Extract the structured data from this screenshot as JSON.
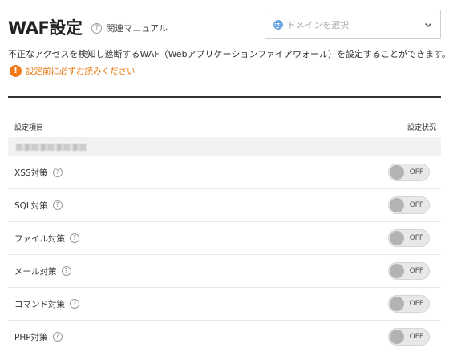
{
  "header": {
    "title": "WAF設定",
    "manual_icon": "help-circle-icon",
    "manual_label": "関連マニュアル"
  },
  "domain_select": {
    "icon": "globe-icon",
    "placeholder": "ドメインを選択",
    "chevron": "chevron-down-icon"
  },
  "description": "不正なアクセスを検知し遮断するWAF（Webアプリケーションファイアウォール）を設定することができます。",
  "notice": {
    "icon": "warning-icon",
    "text": "設定前に必ずお読みください",
    "color": "#e8770f"
  },
  "table": {
    "columns": [
      "設定項目",
      "設定状況"
    ],
    "group_label_redacted": true,
    "rows": [
      {
        "label": "XSS対策",
        "status": "OFF"
      },
      {
        "label": "SQL対策",
        "status": "OFF"
      },
      {
        "label": "ファイル対策",
        "status": "OFF"
      },
      {
        "label": "メール対策",
        "status": "OFF"
      },
      {
        "label": "コマンド対策",
        "status": "OFF"
      },
      {
        "label": "PHP対策",
        "status": "OFF"
      }
    ]
  }
}
